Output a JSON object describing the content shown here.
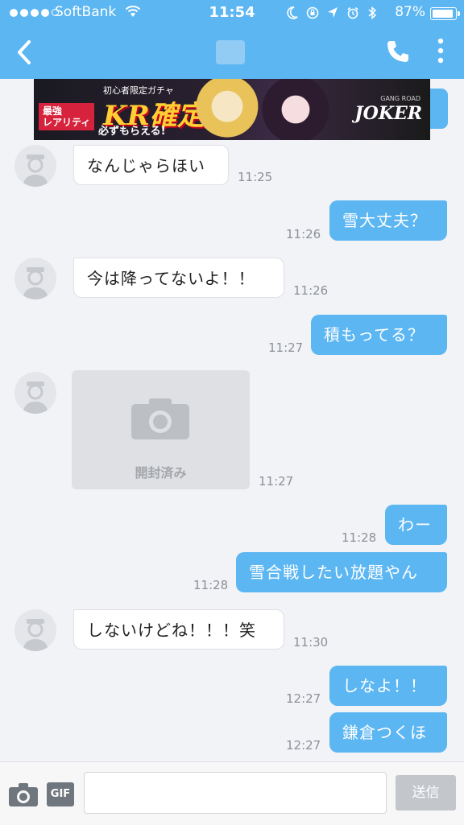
{
  "status_bar": {
    "carrier": "SoftBank",
    "time": "11:54",
    "battery": "87%",
    "battery_level": 0.87
  },
  "nav": {
    "back_icon": "chevron-left-icon",
    "call_icon": "phone-icon",
    "more_icon": "vertical-dots-icon",
    "accent_color": "#5cb6f2"
  },
  "ad": {
    "headline": "初心者限定ガチャ",
    "tag_line1": "最強",
    "tag_line2": "レアリティ",
    "kr_text": "KR確定!",
    "subtext": "必ずもらえる!",
    "brand_small": "GANG ROAD",
    "brand": "JOKER"
  },
  "messages": [
    {
      "dir": "in",
      "text": "なんじゃらほい",
      "time": "11:25"
    },
    {
      "dir": "out",
      "text": "雪大丈夫？",
      "time": "11:26"
    },
    {
      "dir": "in",
      "text": "今は降ってないよ！！",
      "time": "11:26"
    },
    {
      "dir": "out",
      "text": "積もってる？",
      "time": "11:27"
    },
    {
      "dir": "in",
      "photo_label": "開封済み",
      "time": "11:27"
    },
    {
      "dir": "out",
      "text": "わー",
      "time": "11:28"
    },
    {
      "dir": "out",
      "text": "雪合戦したい放題やん",
      "time": "11:28"
    },
    {
      "dir": "in",
      "text": "しないけどね！！！笑",
      "time": "11:30"
    },
    {
      "dir": "out",
      "text": "しなよ！！",
      "time": "12:27"
    },
    {
      "dir": "out",
      "text": "鎌倉つくほ",
      "time": "12:27"
    }
  ],
  "input_bar": {
    "camera_icon": "camera-icon",
    "gif_label": "GIF",
    "placeholder": "",
    "send_label": "送信"
  }
}
